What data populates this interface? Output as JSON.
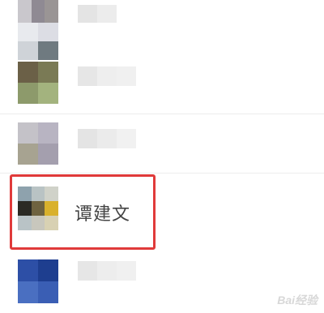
{
  "contacts": [
    {
      "name": ""
    },
    {
      "name": ""
    },
    {
      "name": ""
    },
    {
      "name": ""
    },
    {
      "name": "谭建文"
    },
    {
      "name": ""
    }
  ],
  "highlight_color": "#e03a3a",
  "watermark_text": "Bai经验"
}
